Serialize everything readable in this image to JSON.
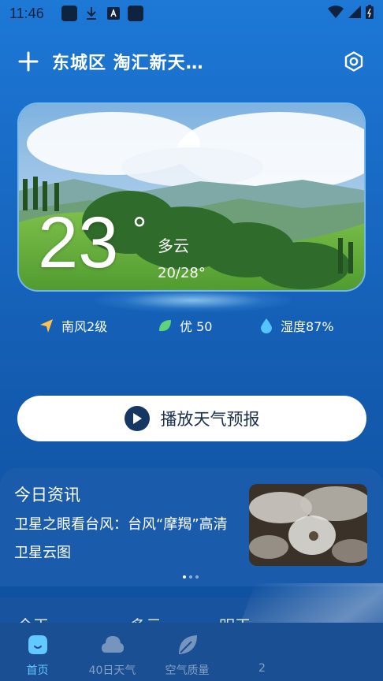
{
  "status_bar": {
    "time": "11:46"
  },
  "header": {
    "location": "东城区 淘汇新天…"
  },
  "current": {
    "temperature": "23",
    "degree_symbol": "°",
    "condition": "多云",
    "range": "20/28°"
  },
  "stats": [
    {
      "icon": "wind-icon",
      "label": "南风2级"
    },
    {
      "icon": "leaf-icon",
      "label": "优 50"
    },
    {
      "icon": "water-drop-icon",
      "label": "湿度87%"
    }
  ],
  "play_button": {
    "label": "播放天气预报"
  },
  "news": {
    "title": "今日资讯",
    "headline": "卫星之眼看台风：台风“摩羯”高清卫星云图"
  },
  "forecast_peek": {
    "today": "今天",
    "condition": "多云",
    "tomorrow": "明天"
  },
  "tabs": [
    {
      "label": "首页",
      "active": true
    },
    {
      "label": "40日天气",
      "active": false
    },
    {
      "label": "空气质量",
      "active": false
    },
    {
      "label": "2",
      "active": false
    }
  ],
  "colors": {
    "accent": "#63c8ff",
    "button_text": "#1a2e4d",
    "play_icon_bg": "#163763"
  }
}
